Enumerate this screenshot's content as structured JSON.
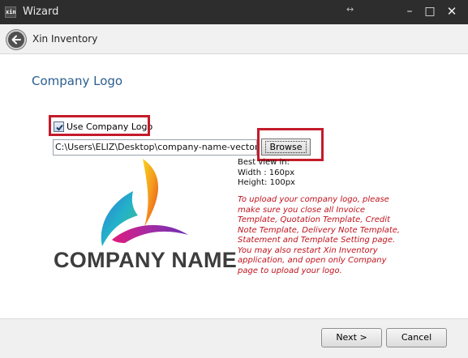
{
  "window": {
    "title": "Wizard",
    "icon_text": "xin"
  },
  "header": {
    "app_name": "Xin Inventory"
  },
  "page": {
    "title": "Company Logo"
  },
  "logo_option": {
    "label": "Use Company Logo",
    "checked": true
  },
  "file_path": {
    "value": "C:\\Users\\ELIZ\\Desktop\\company-name-vector-logo"
  },
  "browse": {
    "label": "Browse"
  },
  "logo_preview": {
    "text": "COMPANY NAME"
  },
  "best_view": {
    "heading": "Best view in:",
    "width": "Width : 160px",
    "height": "Height: 100px"
  },
  "notice_lines": [
    "To upload your company logo, please",
    "make sure you close all Invoice",
    "Template, Quotation Template, Credit",
    "Note Template, Delivery Note Template,",
    "Statement and Template Setting page.",
    "You may also restart Xin Inventory",
    "application, and open only Company",
    "page to upload your logo."
  ],
  "footer": {
    "next_label": "Next >",
    "cancel_label": "Cancel"
  },
  "colors": {
    "title_bar": "#2d2d2d",
    "page_title": "#2b5d8f",
    "highlight_box": "#c41b2a",
    "notice_text": "#c0141e"
  }
}
